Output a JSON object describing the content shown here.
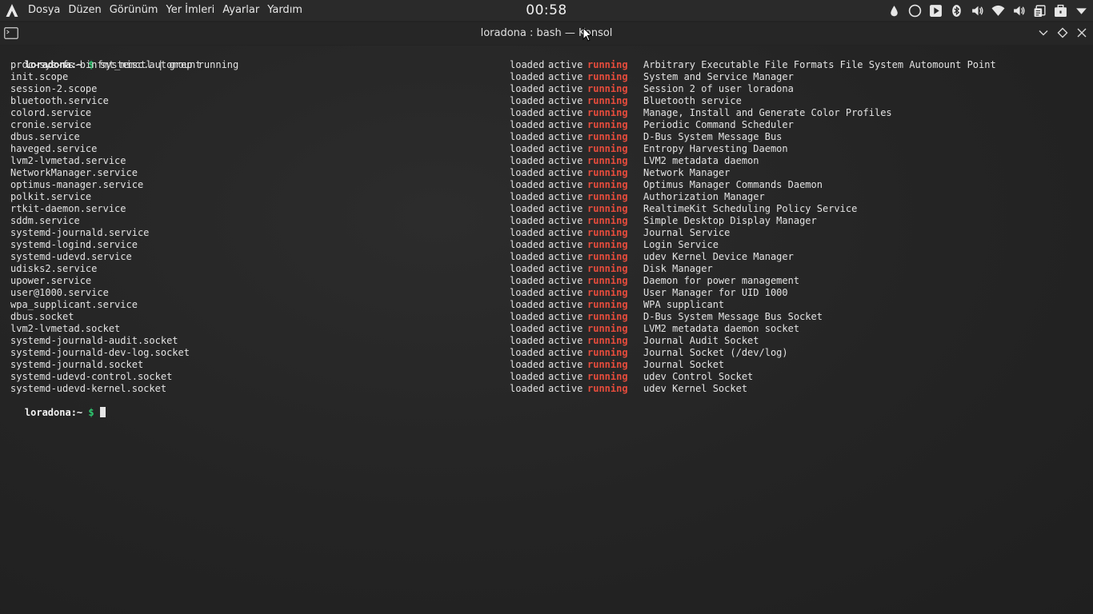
{
  "panel": {
    "menu": [
      "Dosya",
      "Düzen",
      "Görünüm",
      "Yer İmleri",
      "Ayarlar",
      "Yardım"
    ],
    "clock": "00:58",
    "tray_icons": [
      "ink-drop-icon",
      "circle-icon",
      "play-icon",
      "bluetooth-icon",
      "volume-icon",
      "wifi-icon",
      "volume-secondary-icon",
      "clipboard-icon",
      "briefcase-icon",
      "dropdown-arrow-icon"
    ]
  },
  "window": {
    "title": "loradona : bash — Konsol"
  },
  "terminal": {
    "prompt_user": "loradona:~",
    "prompt_symbol": "$",
    "command": "systemctl | grep running",
    "units": [
      {
        "unit": "proc-sys-fs-binfmt_misc.automount",
        "load": "loaded",
        "active": "active",
        "sub": "running",
        "description": "Arbitrary Executable File Formats File System Automount Point"
      },
      {
        "unit": "init.scope",
        "load": "loaded",
        "active": "active",
        "sub": "running",
        "description": "System and Service Manager"
      },
      {
        "unit": "session-2.scope",
        "load": "loaded",
        "active": "active",
        "sub": "running",
        "description": "Session 2 of user loradona"
      },
      {
        "unit": "bluetooth.service",
        "load": "loaded",
        "active": "active",
        "sub": "running",
        "description": "Bluetooth service"
      },
      {
        "unit": "colord.service",
        "load": "loaded",
        "active": "active",
        "sub": "running",
        "description": "Manage, Install and Generate Color Profiles"
      },
      {
        "unit": "cronie.service",
        "load": "loaded",
        "active": "active",
        "sub": "running",
        "description": "Periodic Command Scheduler"
      },
      {
        "unit": "dbus.service",
        "load": "loaded",
        "active": "active",
        "sub": "running",
        "description": "D-Bus System Message Bus"
      },
      {
        "unit": "haveged.service",
        "load": "loaded",
        "active": "active",
        "sub": "running",
        "description": "Entropy Harvesting Daemon"
      },
      {
        "unit": "lvm2-lvmetad.service",
        "load": "loaded",
        "active": "active",
        "sub": "running",
        "description": "LVM2 metadata daemon"
      },
      {
        "unit": "NetworkManager.service",
        "load": "loaded",
        "active": "active",
        "sub": "running",
        "description": "Network Manager"
      },
      {
        "unit": "optimus-manager.service",
        "load": "loaded",
        "active": "active",
        "sub": "running",
        "description": "Optimus Manager Commands Daemon"
      },
      {
        "unit": "polkit.service",
        "load": "loaded",
        "active": "active",
        "sub": "running",
        "description": "Authorization Manager"
      },
      {
        "unit": "rtkit-daemon.service",
        "load": "loaded",
        "active": "active",
        "sub": "running",
        "description": "RealtimeKit Scheduling Policy Service"
      },
      {
        "unit": "sddm.service",
        "load": "loaded",
        "active": "active",
        "sub": "running",
        "description": "Simple Desktop Display Manager"
      },
      {
        "unit": "systemd-journald.service",
        "load": "loaded",
        "active": "active",
        "sub": "running",
        "description": "Journal Service"
      },
      {
        "unit": "systemd-logind.service",
        "load": "loaded",
        "active": "active",
        "sub": "running",
        "description": "Login Service"
      },
      {
        "unit": "systemd-udevd.service",
        "load": "loaded",
        "active": "active",
        "sub": "running",
        "description": "udev Kernel Device Manager"
      },
      {
        "unit": "udisks2.service",
        "load": "loaded",
        "active": "active",
        "sub": "running",
        "description": "Disk Manager"
      },
      {
        "unit": "upower.service",
        "load": "loaded",
        "active": "active",
        "sub": "running",
        "description": "Daemon for power management"
      },
      {
        "unit": "user@1000.service",
        "load": "loaded",
        "active": "active",
        "sub": "running",
        "description": "User Manager for UID 1000"
      },
      {
        "unit": "wpa_supplicant.service",
        "load": "loaded",
        "active": "active",
        "sub": "running",
        "description": "WPA supplicant"
      },
      {
        "unit": "dbus.socket",
        "load": "loaded",
        "active": "active",
        "sub": "running",
        "description": "D-Bus System Message Bus Socket"
      },
      {
        "unit": "lvm2-lvmetad.socket",
        "load": "loaded",
        "active": "active",
        "sub": "running",
        "description": "LVM2 metadata daemon socket"
      },
      {
        "unit": "systemd-journald-audit.socket",
        "load": "loaded",
        "active": "active",
        "sub": "running",
        "description": "Journal Audit Socket"
      },
      {
        "unit": "systemd-journald-dev-log.socket",
        "load": "loaded",
        "active": "active",
        "sub": "running",
        "description": "Journal Socket (/dev/log)"
      },
      {
        "unit": "systemd-journald.socket",
        "load": "loaded",
        "active": "active",
        "sub": "running",
        "description": "Journal Socket"
      },
      {
        "unit": "systemd-udevd-control.socket",
        "load": "loaded",
        "active": "active",
        "sub": "running",
        "description": "udev Control Socket"
      },
      {
        "unit": "systemd-udevd-kernel.socket",
        "load": "loaded",
        "active": "active",
        "sub": "running",
        "description": "udev Kernel Socket"
      }
    ]
  },
  "colors": {
    "running": "#e74c3c",
    "prompt_dollar": "#2ecc71",
    "terminal_bg": "#232323"
  }
}
